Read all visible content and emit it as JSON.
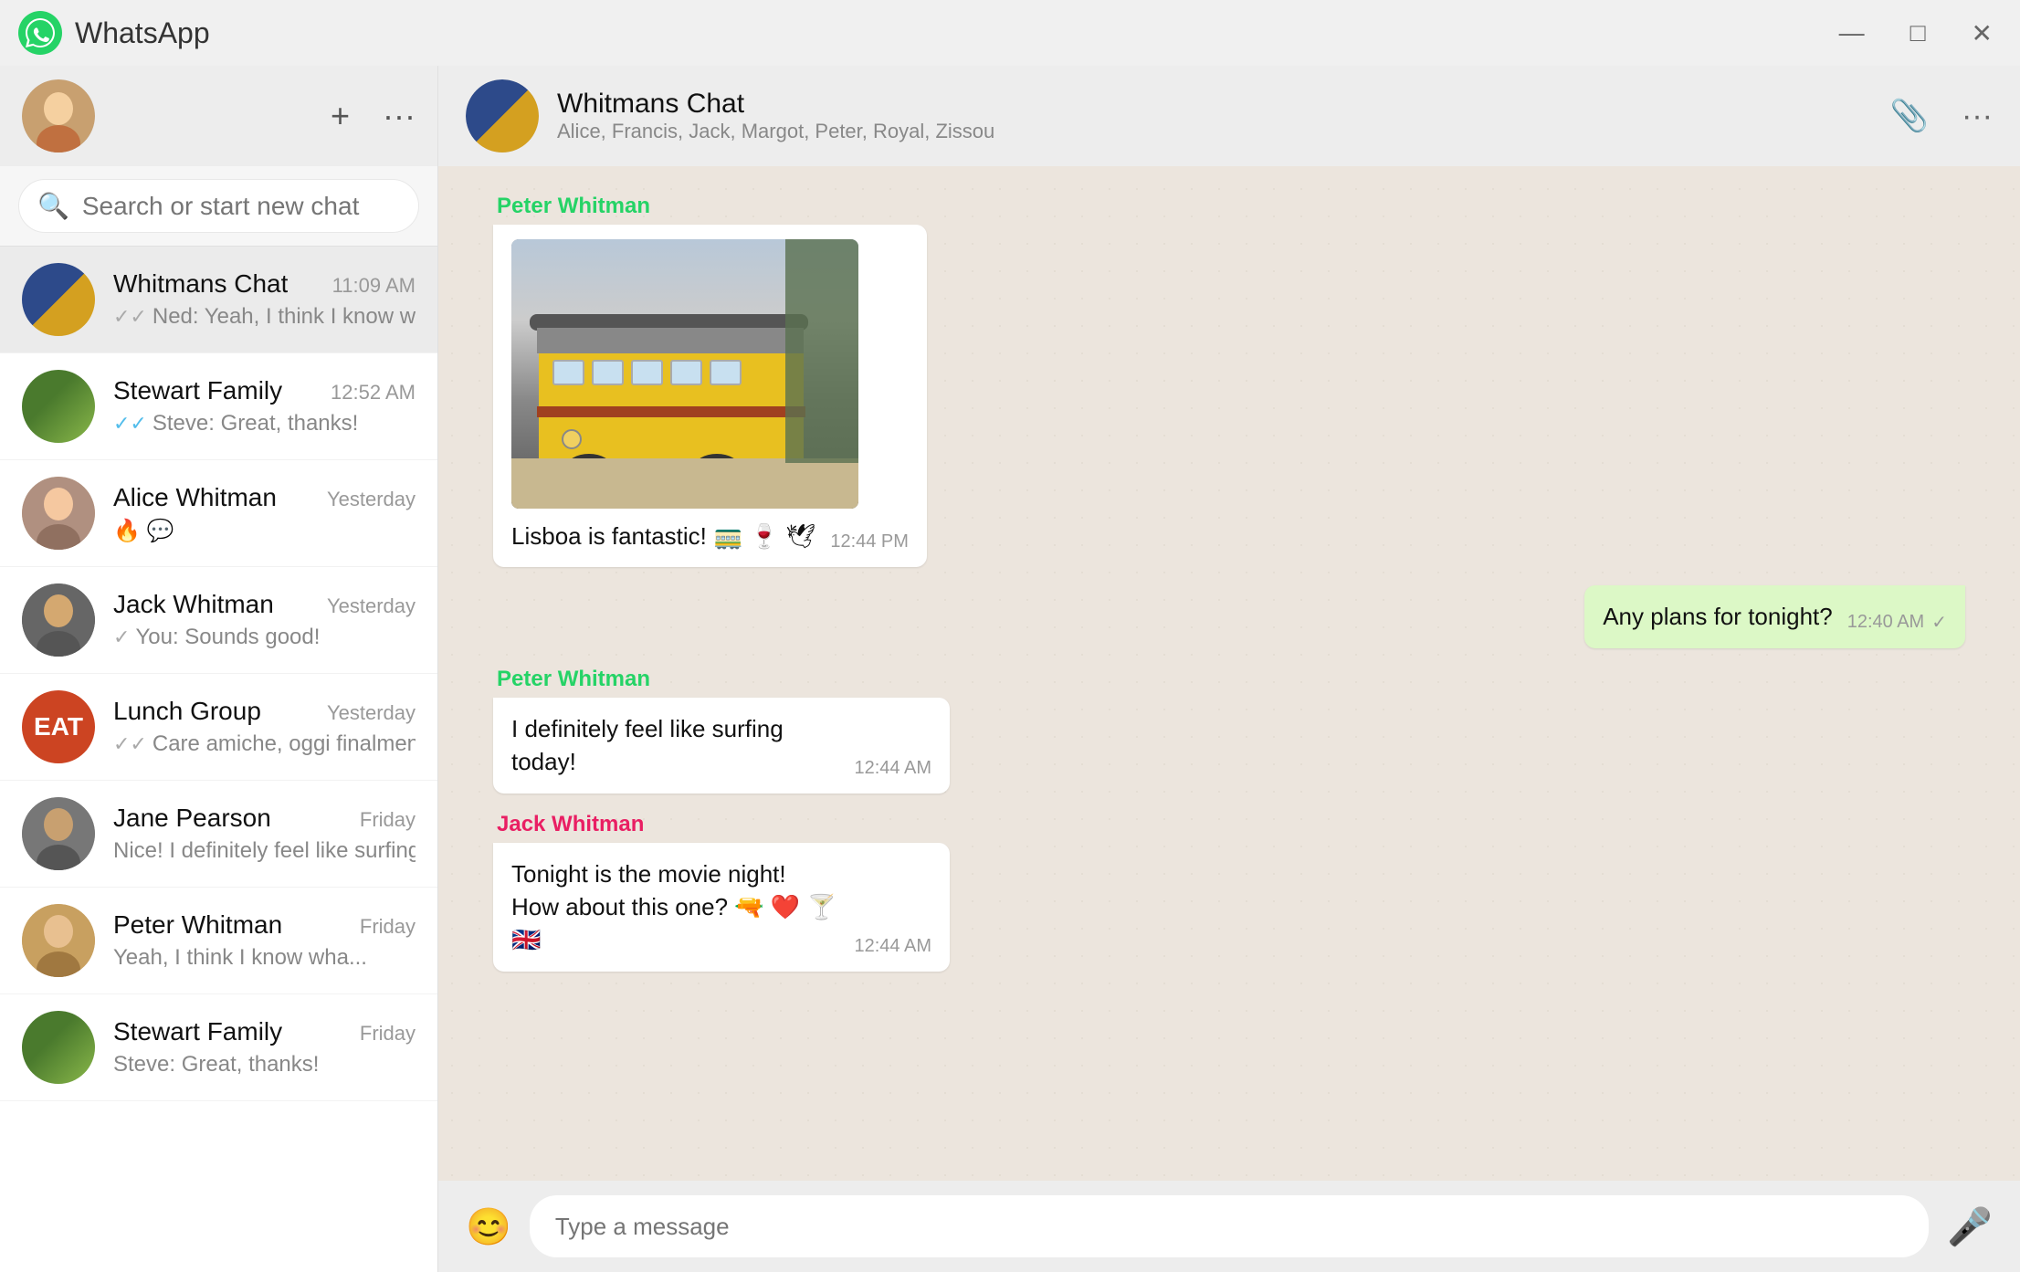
{
  "app": {
    "title": "WhatsApp",
    "logo_emoji": "📱"
  },
  "titlebar": {
    "title": "WhatsApp",
    "minimize": "—",
    "maximize": "□",
    "close": "✕"
  },
  "sidebar": {
    "user_avatar_alt": "User avatar",
    "new_chat_label": "+",
    "menu_label": "⋯",
    "search": {
      "placeholder": "Search or start new chat",
      "icon": "🔍"
    },
    "chats": [
      {
        "id": "whitmans",
        "name": "Whitmans Chat",
        "time": "11:09 AM",
        "preview": "Ned: Yeah, I think I know wha...",
        "check": "double",
        "check_color": "gray",
        "active": true
      },
      {
        "id": "stewart",
        "name": "Stewart Family",
        "time": "12:52 AM",
        "preview": "Steve: Great, thanks!",
        "check": "double",
        "check_color": "blue"
      },
      {
        "id": "alice",
        "name": "Alice Whitman",
        "time": "Yesterday",
        "preview": "🔥 💬",
        "check": "none"
      },
      {
        "id": "jack",
        "name": "Jack Whitman",
        "time": "Yesterday",
        "preview": "You: Sounds good!",
        "check": "single",
        "check_color": "gray"
      },
      {
        "id": "lunch",
        "name": "Lunch Group",
        "time": "Yesterday",
        "preview": "Care amiche, oggi finalmente posso",
        "check": "double",
        "check_color": "gray"
      },
      {
        "id": "jane",
        "name": "Jane Pearson",
        "time": "Friday",
        "preview": "Nice! I definitely feel like surfing",
        "check": "none"
      },
      {
        "id": "peter",
        "name": "Peter Whitman",
        "time": "Friday",
        "preview": "Yeah, I think I know wha...",
        "check": "none"
      },
      {
        "id": "stewart2",
        "name": "Stewart Family",
        "time": "Friday",
        "preview": "Steve: Great, thanks!",
        "check": "none"
      }
    ]
  },
  "chat_header": {
    "name": "Whitmans Chat",
    "members": "Alice, Francis, Jack, Margot, Peter, Royal, Zissou",
    "attach_icon": "📎",
    "menu_icon": "⋯"
  },
  "messages": [
    {
      "id": "msg1",
      "type": "incoming",
      "sender": "Peter Whitman",
      "sender_color": "#25d366",
      "has_image": true,
      "image_label": "Tram photo",
      "text": "Lisboa is fantastic! 🚃 🍷 🕊",
      "time": "12:44 PM",
      "check": ""
    },
    {
      "id": "msg2",
      "type": "outgoing",
      "sender": "",
      "sender_color": "",
      "text": "Any plans for tonight?",
      "time": "12:40 AM",
      "check": "✓"
    },
    {
      "id": "msg3",
      "type": "incoming",
      "sender": "Peter Whitman",
      "sender_color": "#25d366",
      "text": "I definitely feel like surfing today!",
      "time": "12:44 AM",
      "check": ""
    },
    {
      "id": "msg4",
      "type": "incoming",
      "sender": "Jack Whitman",
      "sender_color": "#e91e63",
      "text": "Tonight is the movie night! How about this one? 🔫 ❤ 🍸 🇬🇧",
      "time": "12:44 AM",
      "check": ""
    }
  ],
  "input": {
    "emoji_icon": "😊",
    "placeholder": "Type a message",
    "mic_icon": "🎤"
  }
}
